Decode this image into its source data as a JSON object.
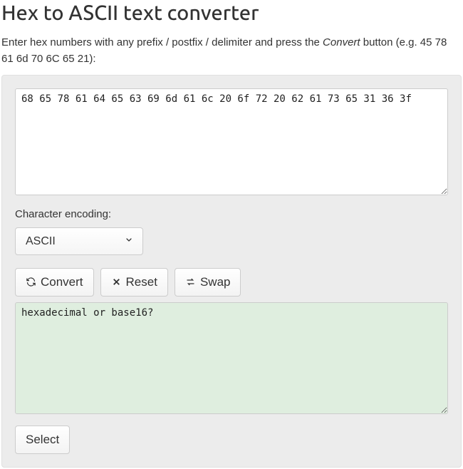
{
  "title": "Hex to ASCII text converter",
  "intro_pre": "Enter hex numbers with any prefix / postfix / delimiter and press the ",
  "intro_em": "Convert",
  "intro_post": " button (e.g. 45 78 61 6d 70 6C 65 21):",
  "input_value": "68 65 78 61 64 65 63 69 6d 61 6c 20 6f 72 20 62 61 73 65 31 36 3f",
  "encoding_label": "Character encoding:",
  "encoding_selected": "ASCII",
  "buttons": {
    "convert": "Convert",
    "reset": "Reset",
    "swap": "Swap"
  },
  "output_value": "hexadecimal or base16?",
  "select_button": "Select"
}
